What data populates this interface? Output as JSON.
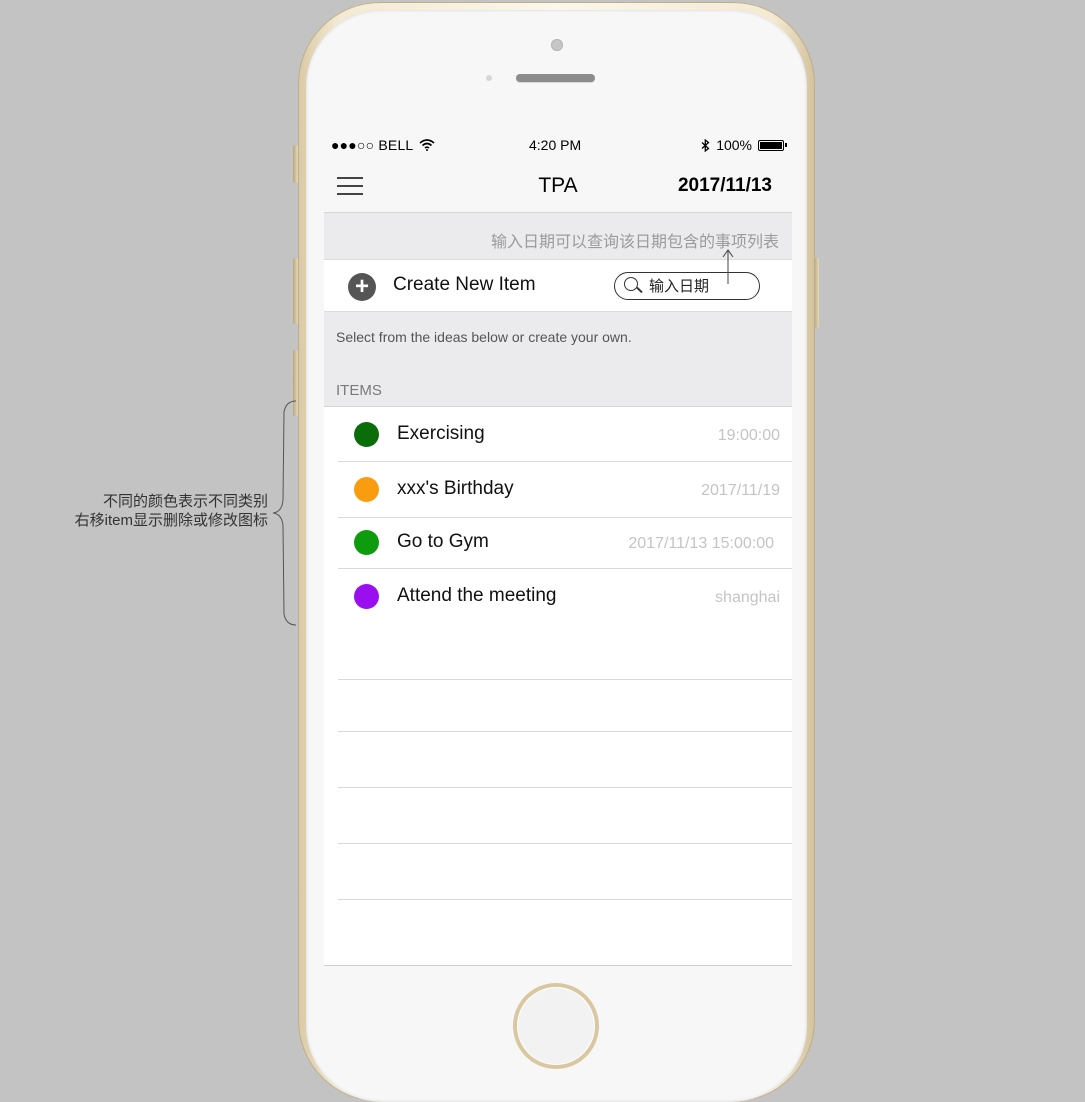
{
  "status_bar": {
    "carrier": "●●●○○ BELL",
    "time": "4:20 PM",
    "battery": "100%"
  },
  "nav": {
    "title": "TPA",
    "date": "2017/11/13"
  },
  "hint": "输入日期可以查询该日期包含的事项列表",
  "create": {
    "label": "Create New Item",
    "date_placeholder": "输入日期"
  },
  "select_text": "Select from the ideas below or create your own.",
  "items_header": "ITEMS",
  "items": [
    {
      "title": "Exercising",
      "meta": "19:00:00",
      "color": "#0a6d0a"
    },
    {
      "title": "xxx's Birthday",
      "meta": "2017/11/19",
      "color": "#f99c0f"
    },
    {
      "title": "Go to Gym",
      "meta": "2017/11/13 15:00:00",
      "color": "#0e9b0e"
    },
    {
      "title": "Attend the meeting",
      "meta": "shanghai",
      "color": "#9a0ef0"
    }
  ],
  "annotation": {
    "line1": "不同的颜色表示不同类别",
    "line2": "右移item显示删除或修改图标"
  },
  "colors": {
    "background": "#c3c3c3",
    "screen": "#f7f7f7",
    "section": "#ebebee"
  },
  "icons": [
    "menu-icon",
    "plus-icon",
    "search-icon",
    "wifi-icon",
    "bluetooth-icon",
    "battery-icon"
  ]
}
